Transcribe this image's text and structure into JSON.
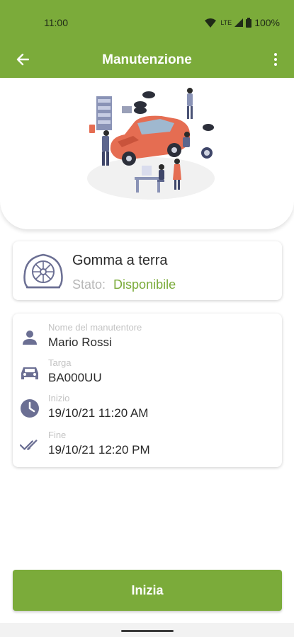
{
  "status_bar": {
    "time": "11:00",
    "network": "LTE",
    "battery": "100%"
  },
  "app_bar": {
    "title": "Manutenzione",
    "back_icon": "arrow-left-icon",
    "menu_icon": "more-vertical-icon"
  },
  "colors": {
    "brand": "#7bab3a",
    "icon": "#6b6f93"
  },
  "type_card": {
    "icon": "flat-tire-icon",
    "title": "Gomma a terra",
    "status_label": "Stato:",
    "status_value": "Disponibile"
  },
  "details": {
    "technician": {
      "icon": "person-icon",
      "label": "Nome del manutentore",
      "value": "Mario Rossi"
    },
    "plate": {
      "icon": "car-icon",
      "label": "Targa",
      "value": "BA000UU"
    },
    "start": {
      "icon": "clock-icon",
      "label": "Inizio",
      "value": "19/10/21 11:20 AM"
    },
    "end": {
      "icon": "double-check-icon",
      "label": "Fine",
      "value": "19/10/21 12:20 PM"
    }
  },
  "action_button": {
    "label": "Inizia"
  }
}
